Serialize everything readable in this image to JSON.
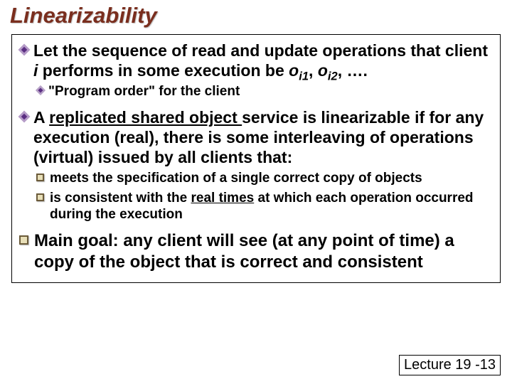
{
  "title": "Linearizability",
  "b1": {
    "line1_pre": "Let the sequence of read and update operations that client ",
    "line1_i": "i",
    "line1_mid": " performs in some execution be ",
    "op1_o": "o",
    "op1_sub": "i1",
    "comma1": ", ",
    "op2_o": "o",
    "op2_sub": "i2",
    "tail": ", …."
  },
  "b1s": "\"Program order\" for the client",
  "b2": {
    "pre": "A ",
    "ul": "replicated shared object ",
    "mid1": "service is ",
    "lin": "linearizable",
    "rest": " if for any execution (real), there is some interleaving of operations (virtual) issued by all clients that:"
  },
  "b2a": "meets the specification of a single correct copy of objects",
  "b2b": {
    "pre": "is consistent with the ",
    "ul": "real times",
    "post": " at which each operation occurred during the execution"
  },
  "b3": "Main goal: any client will see (at any point of time) a copy of the object that is correct and consistent",
  "footer": "Lecture 19 -13"
}
